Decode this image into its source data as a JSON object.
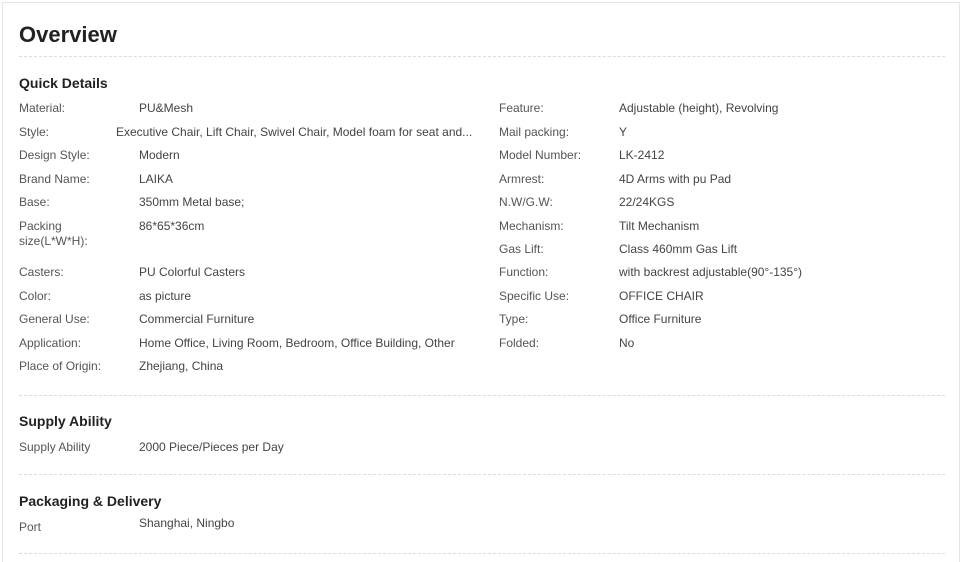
{
  "title": "Overview",
  "quick_details": {
    "heading": "Quick Details",
    "left": [
      {
        "label": "Material:",
        "value": "PU&Mesh"
      },
      {
        "label": "Style:",
        "value": "Executive Chair, Lift Chair, Swivel Chair, Model foam for seat and..."
      },
      {
        "label": "Design Style:",
        "value": "Modern"
      },
      {
        "label": "Brand Name:",
        "value": "LAIKA"
      },
      {
        "label": "Base:",
        "value": "350mm Metal base;"
      },
      {
        "label": "Packing size(L*W*H):",
        "value": "86*65*36cm"
      },
      {
        "label": "Casters:",
        "value": "PU Colorful Casters"
      },
      {
        "label": "Color:",
        "value": "as picture"
      },
      {
        "label": "General Use:",
        "value": "Commercial Furniture"
      },
      {
        "label": "Application:",
        "value": "Home Office, Living Room, Bedroom, Office Building, Other"
      },
      {
        "label": "Place of Origin:",
        "value": "Zhejiang, China"
      }
    ],
    "right": [
      {
        "label": "Feature:",
        "value": "Adjustable (height), Revolving"
      },
      {
        "label": "Mail packing:",
        "value": "Y"
      },
      {
        "label": "Model Number:",
        "value": "LK-2412"
      },
      {
        "label": "Armrest:",
        "value": "4D Arms with pu Pad"
      },
      {
        "label": "N.W/G.W:",
        "value": "22/24KGS"
      },
      {
        "label": "Mechanism:",
        "value": "Tilt Mechanism"
      },
      {
        "label": "Gas Lift:",
        "value": "Class 460mm Gas Lift"
      },
      {
        "label": "Function:",
        "value": "with backrest adjustable(90°-135°)"
      },
      {
        "label": "Specific Use:",
        "value": "OFFICE CHAIR"
      },
      {
        "label": "Type:",
        "value": "Office Furniture"
      },
      {
        "label": "Folded:",
        "value": "No"
      }
    ]
  },
  "supply_ability": {
    "heading": "Supply Ability",
    "label": "Supply Ability",
    "value": "2000 Piece/Pieces per Day"
  },
  "packaging_delivery": {
    "heading": "Packaging & Delivery",
    "label": "Port",
    "value": "Shanghai, Ningbo"
  }
}
